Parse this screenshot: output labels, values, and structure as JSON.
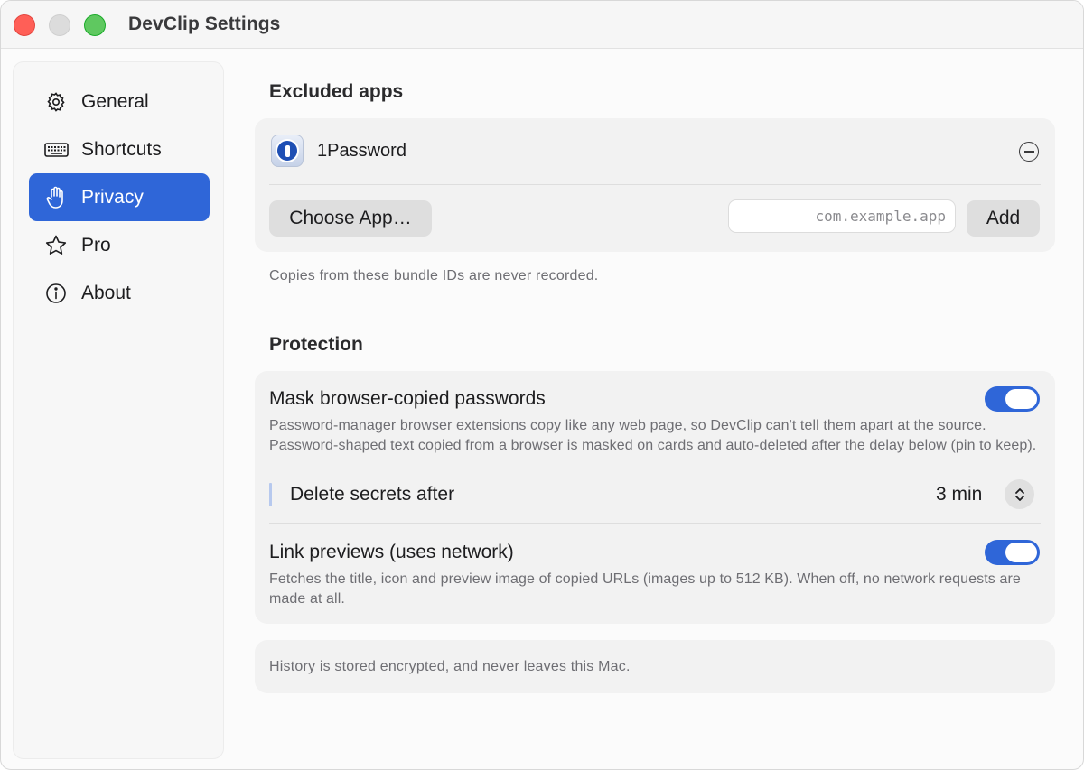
{
  "window": {
    "title": "DevClip Settings"
  },
  "sidebar": {
    "items": [
      {
        "label": "General",
        "icon": "gear-icon",
        "active": false
      },
      {
        "label": "Shortcuts",
        "icon": "keyboard-icon",
        "active": false
      },
      {
        "label": "Privacy",
        "icon": "hand-icon",
        "active": true
      },
      {
        "label": "Pro",
        "icon": "star-icon",
        "active": false
      },
      {
        "label": "About",
        "icon": "info-icon",
        "active": false
      }
    ]
  },
  "excluded_apps": {
    "title": "Excluded apps",
    "apps": [
      {
        "name": "1Password",
        "icon": "1password-icon"
      }
    ],
    "choose_button": "Choose App…",
    "bundle_placeholder": "com.example.app",
    "add_button": "Add",
    "caption": "Copies from these bundle IDs are never recorded."
  },
  "protection": {
    "title": "Protection",
    "mask": {
      "label": "Mask browser-copied passwords",
      "enabled": true,
      "description": "Password-manager browser extensions copy like any web page, so DevClip can't tell them apart at the source. Password-shaped text copied from a browser is masked on cards and auto-deleted after the delay below (pin to keep).",
      "delete_label": "Delete secrets after",
      "delete_value": "3 min"
    },
    "link_previews": {
      "label": "Link previews (uses network)",
      "enabled": true,
      "description": "Fetches the title, icon and preview image of copied URLs (images up to 512 KB). When off, no network requests are made at all."
    }
  },
  "footer": {
    "note": "History is stored encrypted, and never leaves this Mac."
  },
  "colors": {
    "accent": "#2f66d8",
    "close": "#ff5f57",
    "zoom": "#5fc860"
  }
}
